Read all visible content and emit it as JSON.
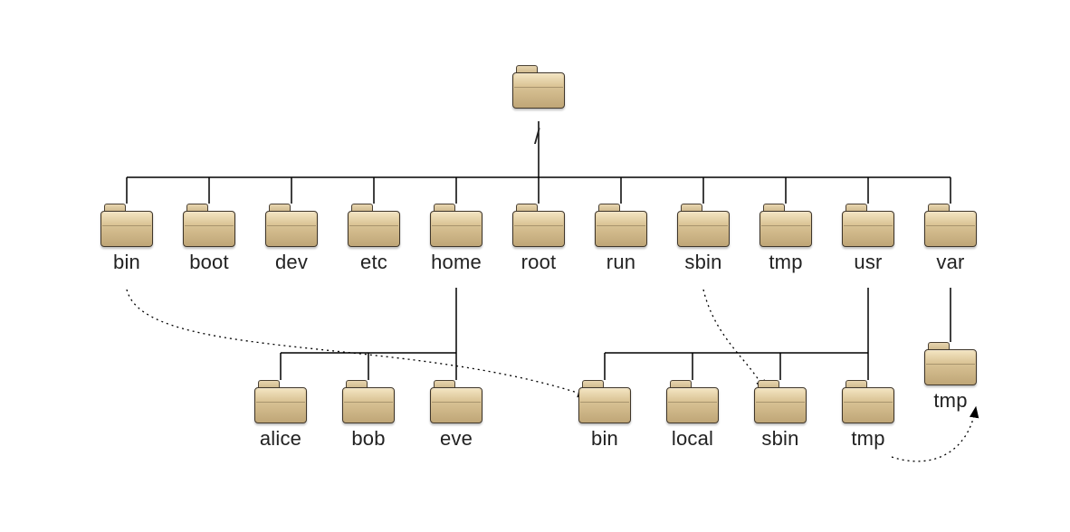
{
  "root_label": "/",
  "level1": [
    {
      "name": "bin"
    },
    {
      "name": "boot"
    },
    {
      "name": "dev"
    },
    {
      "name": "etc"
    },
    {
      "name": "home"
    },
    {
      "name": "root"
    },
    {
      "name": "run"
    },
    {
      "name": "sbin"
    },
    {
      "name": "tmp"
    },
    {
      "name": "usr"
    },
    {
      "name": "var"
    }
  ],
  "home_children": [
    {
      "name": "alice"
    },
    {
      "name": "bob"
    },
    {
      "name": "eve"
    }
  ],
  "usr_children": [
    {
      "name": "bin"
    },
    {
      "name": "local"
    },
    {
      "name": "sbin"
    },
    {
      "name": "tmp"
    }
  ],
  "var_children": [
    {
      "name": "tmp"
    }
  ],
  "symlinks": [
    {
      "from": "bin",
      "to": "usr/bin"
    },
    {
      "from": "sbin",
      "to": "usr/sbin"
    },
    {
      "from": "usr/tmp",
      "to": "var/tmp"
    }
  ]
}
